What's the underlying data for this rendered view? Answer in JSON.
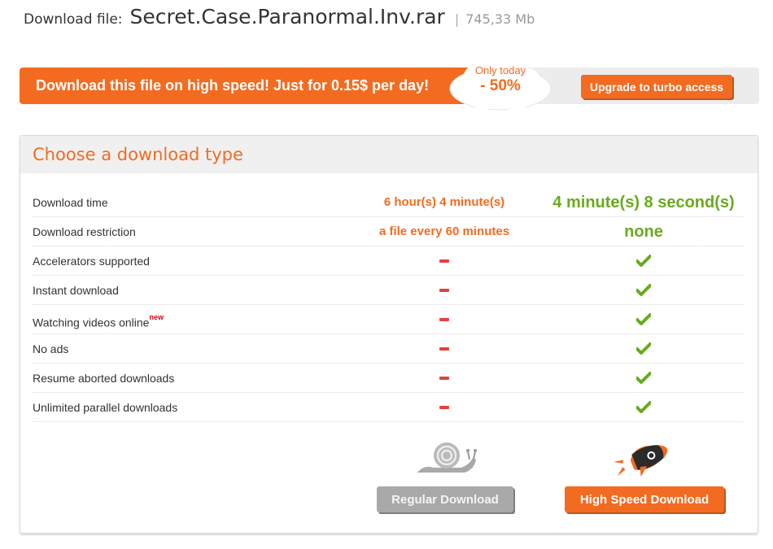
{
  "file": {
    "label": "Download file:",
    "name": "Secret.Case.Paranormal.Inv.rar",
    "separator": "|",
    "size": "745,33 Mb"
  },
  "promo": {
    "text": "Download this file on high speed! Just for 0.15$ per day!",
    "badge_line1": "Only today",
    "badge_line2": "- 50%",
    "upgrade_label": "Upgrade to turbo access"
  },
  "panel": {
    "title": "Choose a download type",
    "rows": [
      {
        "feature": "Download time",
        "regular": "6 hour(s) 4 minute(s)",
        "high_speed": "4 minute(s) 8 second(s)"
      },
      {
        "feature": "Download restriction",
        "regular": "a file every 60 minutes",
        "high_speed": "none"
      },
      {
        "feature": "Accelerators supported",
        "regular": "minus",
        "high_speed": "check"
      },
      {
        "feature": "Instant download",
        "regular": "minus",
        "high_speed": "check"
      },
      {
        "feature": "Watching videos online",
        "feature_badge": "new",
        "regular": "minus",
        "high_speed": "check"
      },
      {
        "feature": "No ads",
        "regular": "minus",
        "high_speed": "check"
      },
      {
        "feature": "Resume aborted downloads",
        "regular": "minus",
        "high_speed": "check"
      },
      {
        "feature": "Unlimited parallel downloads",
        "regular": "minus",
        "high_speed": "check"
      }
    ],
    "regular_button": "Regular Download",
    "high_speed_button": "High Speed Download",
    "regular_icon": "snail-icon",
    "high_speed_icon": "rocket-icon"
  },
  "colors": {
    "accent": "#f36b21",
    "positive": "#6aaa1f",
    "negative": "#e5413c"
  }
}
